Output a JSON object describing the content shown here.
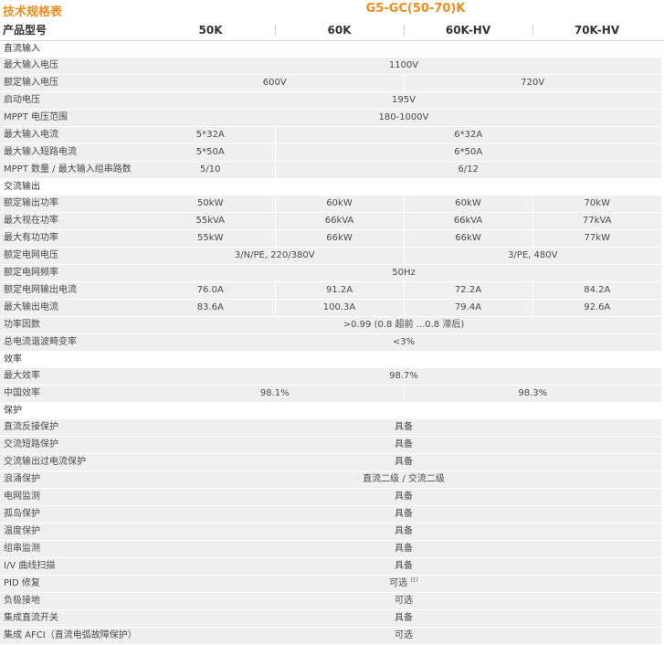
{
  "doc_title": "技术规格表",
  "model_series": "G5-GC(50-70)K",
  "header": {
    "label": "产品型号",
    "models": [
      "50K",
      "60K",
      "60K-HV",
      "70K-HV"
    ]
  },
  "sections": {
    "dc_input": "直流输入",
    "ac_output": "交流输出",
    "efficiency": "效率",
    "protection": "保护"
  },
  "rows": {
    "max_input_voltage": {
      "label": "最大输入电压",
      "v1": "1100V"
    },
    "rated_input_voltage": {
      "label": "额定输入电压",
      "v1": "600V",
      "v2": "720V"
    },
    "startup_voltage": {
      "label": "启动电压",
      "v1": "195V"
    },
    "mppt_range": {
      "label": "MPPT 电压范围",
      "v1": "180-1000V"
    },
    "max_input_current": {
      "label": "最大输入电流",
      "v1": "5*32A",
      "v2": "6*32A"
    },
    "max_short_current": {
      "label": "最大输入短路电流",
      "v1": "5*50A",
      "v2": "6*50A"
    },
    "mppt_count": {
      "label": "MPPT 数量 / 最大输入组串路数",
      "v1": "5/10",
      "v2": "6/12"
    },
    "rated_output_power": {
      "label": "额定输出功率",
      "v1": "50kW",
      "v2": "60kW",
      "v3": "60kW",
      "v4": "70kW"
    },
    "max_apparent_power": {
      "label": "最大视在功率",
      "v1": "55kVA",
      "v2": "66kVA",
      "v3": "66kVA",
      "v4": "77kVA"
    },
    "max_active_power": {
      "label": "最大有功功率",
      "v1": "55kW",
      "v2": "66kW",
      "v3": "66kW",
      "v4": "77kW"
    },
    "rated_grid_voltage": {
      "label": "额定电网电压",
      "v1": "3/N/PE, 220/380V",
      "v2": "3/PE, 480V"
    },
    "rated_grid_frequency": {
      "label": "额定电网频率",
      "v1": "50Hz"
    },
    "rated_grid_current": {
      "label": "额定电网输出电流",
      "v1": "76.0A",
      "v2": "91.2A",
      "v3": "72.2A",
      "v4": "84.2A"
    },
    "max_output_current": {
      "label": "最大输出电流",
      "v1": "83.6A",
      "v2": "100.3A",
      "v3": "79.4A",
      "v4": "92.6A"
    },
    "power_factor": {
      "label": "功率因数",
      "v1": ">0.99 (0.8 超前 ...0.8 滞后)"
    },
    "thd": {
      "label": "总电流谐波畸变率",
      "v1": "<3%"
    },
    "max_efficiency": {
      "label": "最大效率",
      "v1": "98.7%"
    },
    "china_efficiency": {
      "label": "中国效率",
      "v1": "98.1%",
      "v2": "98.3%"
    },
    "dc_reverse": {
      "label": "直流反接保护",
      "v1": "具备"
    },
    "ac_short": {
      "label": "交流短路保护",
      "v1": "具备"
    },
    "ac_overcurrent": {
      "label": "交流输出过电流保护",
      "v1": "具备"
    },
    "surge": {
      "label": "浪涌保护",
      "v1": "直流二级 / 交流二级"
    },
    "grid_monitor": {
      "label": "电网监测",
      "v1": "具备"
    },
    "island": {
      "label": "孤岛保护",
      "v1": "具备"
    },
    "temp": {
      "label": "温度保护",
      "v1": "具备"
    },
    "string_monitor": {
      "label": "组串监测",
      "v1": "具备"
    },
    "iv_scan": {
      "label": "I/V 曲线扫描",
      "v1": "具备"
    },
    "pid": {
      "label": "PID 修复",
      "v1": "可选",
      "note": "(1)"
    },
    "neg_ground": {
      "label": "负极接地",
      "v1": "可选"
    },
    "dc_switch": {
      "label": "集成直流开关",
      "v1": "具备"
    },
    "afci": {
      "label": "集成 AFCI（直流电弧故障保护）",
      "v1": "可选"
    }
  }
}
